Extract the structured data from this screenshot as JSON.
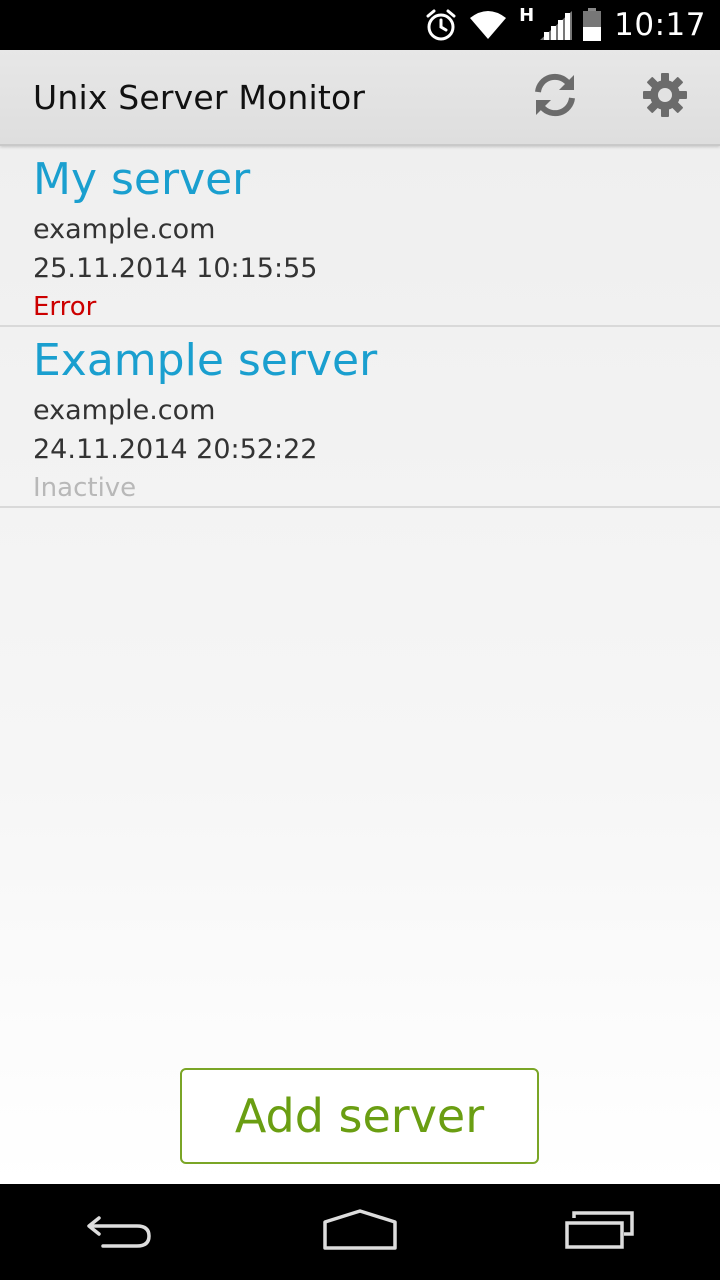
{
  "status_bar": {
    "time": "10:17",
    "network_type": "H",
    "icons": [
      "alarm-icon",
      "wifi-icon",
      "signal-icon",
      "battery-icon"
    ]
  },
  "action_bar": {
    "title": "Unix Server Monitor",
    "actions": [
      "refresh-icon",
      "settings-gear-icon"
    ]
  },
  "servers": [
    {
      "name": "My server",
      "host": "example.com",
      "timestamp": "25.11.2014 10:15:55",
      "status": "Error",
      "status_color": "#cc0000"
    },
    {
      "name": "Example server",
      "host": "example.com",
      "timestamp": "24.11.2014 20:52:22",
      "status": "Inactive",
      "status_color": "#b8b8b8"
    }
  ],
  "add_button": {
    "label": "Add server"
  },
  "nav_bar": {
    "icons": [
      "back-icon",
      "home-icon",
      "recent-apps-icon"
    ]
  },
  "colors": {
    "server_name": "#1a9fcf",
    "add_button_accent": "#6a9e12",
    "error": "#cc0000",
    "inactive": "#b8b8b8"
  }
}
